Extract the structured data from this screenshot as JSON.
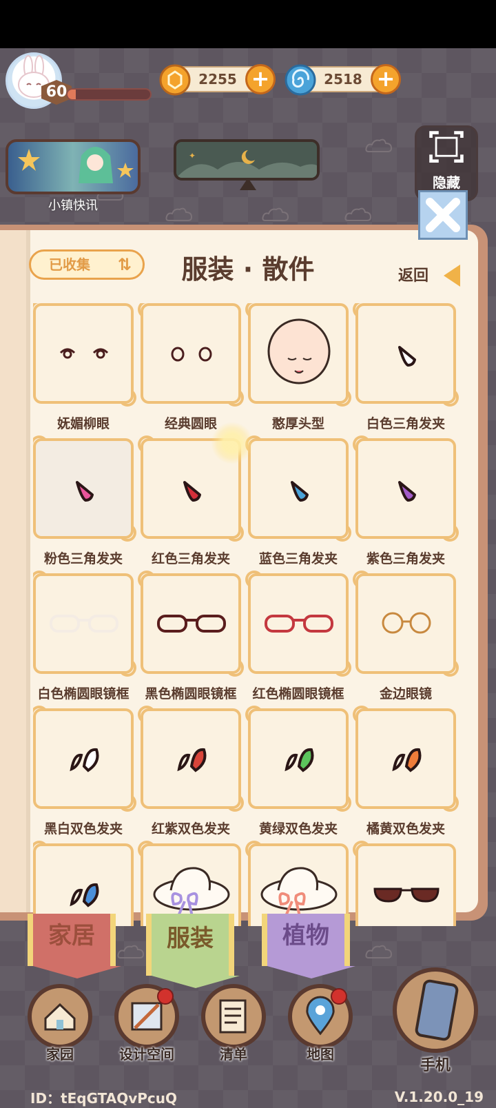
{
  "player": {
    "level": "60",
    "xp_fraction": 0.1
  },
  "currencies": [
    {
      "name": "gold-coin",
      "value": "2255",
      "color": "#f4a32c"
    },
    {
      "name": "blue-swirl",
      "value": "2518",
      "color": "#4aa3d9"
    }
  ],
  "news": {
    "label": "小镇快讯"
  },
  "hide": {
    "label": "隐藏"
  },
  "panel": {
    "filter_label": "已收集",
    "title": "服装 · 散件",
    "back_label": "返回"
  },
  "items": [
    {
      "name": "妩媚柳眼",
      "icon": "eyes-almond"
    },
    {
      "name": "经典圆眼",
      "icon": "eyes-round"
    },
    {
      "name": "憨厚头型",
      "icon": "head-bald"
    },
    {
      "name": "白色三角发夹",
      "icon": "triangle-clip",
      "color": "#ffffff"
    },
    {
      "name": "粉色三角发夹",
      "icon": "triangle-clip",
      "color": "#e8559a"
    },
    {
      "name": "红色三角发夹",
      "icon": "triangle-clip",
      "color": "#d4303a"
    },
    {
      "name": "蓝色三角发夹",
      "icon": "triangle-clip",
      "color": "#4aa3d9"
    },
    {
      "name": "紫色三角发夹",
      "icon": "triangle-clip",
      "color": "#a35cc9"
    },
    {
      "name": "白色椭圆眼镜框",
      "icon": "glasses-oval",
      "color": "#f4ece4"
    },
    {
      "name": "黑色椭圆眼镜框",
      "icon": "glasses-oval",
      "color": "#5a1d1d"
    },
    {
      "name": "红色椭圆眼镜框",
      "icon": "glasses-oval",
      "color": "#c4383f"
    },
    {
      "name": "金边眼镜",
      "icon": "glasses-round",
      "color": "#c8893f"
    },
    {
      "name": "黑白双色发夹",
      "icon": "dual-clip",
      "color": "#ffffff"
    },
    {
      "name": "红紫双色发夹",
      "icon": "dual-clip",
      "color": "#d9453a"
    },
    {
      "name": "黄绿双色发夹",
      "icon": "dual-clip",
      "color": "#5cc45c"
    },
    {
      "name": "橘黄双色发夹",
      "icon": "dual-clip",
      "color": "#ef7d3a"
    },
    {
      "name": "",
      "icon": "dual-clip",
      "color": "#4a8fd9"
    },
    {
      "name": "",
      "icon": "sun-hat",
      "color": "#a892e0"
    },
    {
      "name": "",
      "icon": "sun-hat",
      "color": "#f08c7a"
    },
    {
      "name": "",
      "icon": "sunglasses",
      "color": "#6a2a24"
    }
  ],
  "tabs": [
    {
      "label": "家居"
    },
    {
      "label": "服装"
    },
    {
      "label": "植物"
    }
  ],
  "nav": [
    {
      "label": "家园",
      "icon": "house-icon",
      "badge": false
    },
    {
      "label": "设计空间",
      "icon": "design-icon",
      "badge": true
    },
    {
      "label": "清单",
      "icon": "list-icon",
      "badge": false
    },
    {
      "label": "地图",
      "icon": "map-pin-icon",
      "badge": true
    },
    {
      "label": "手机",
      "icon": "phone-icon",
      "badge": false
    }
  ],
  "footer": {
    "id": "ID：tEqGTAQvPcuQ",
    "version": "V.1.20.0_19"
  }
}
